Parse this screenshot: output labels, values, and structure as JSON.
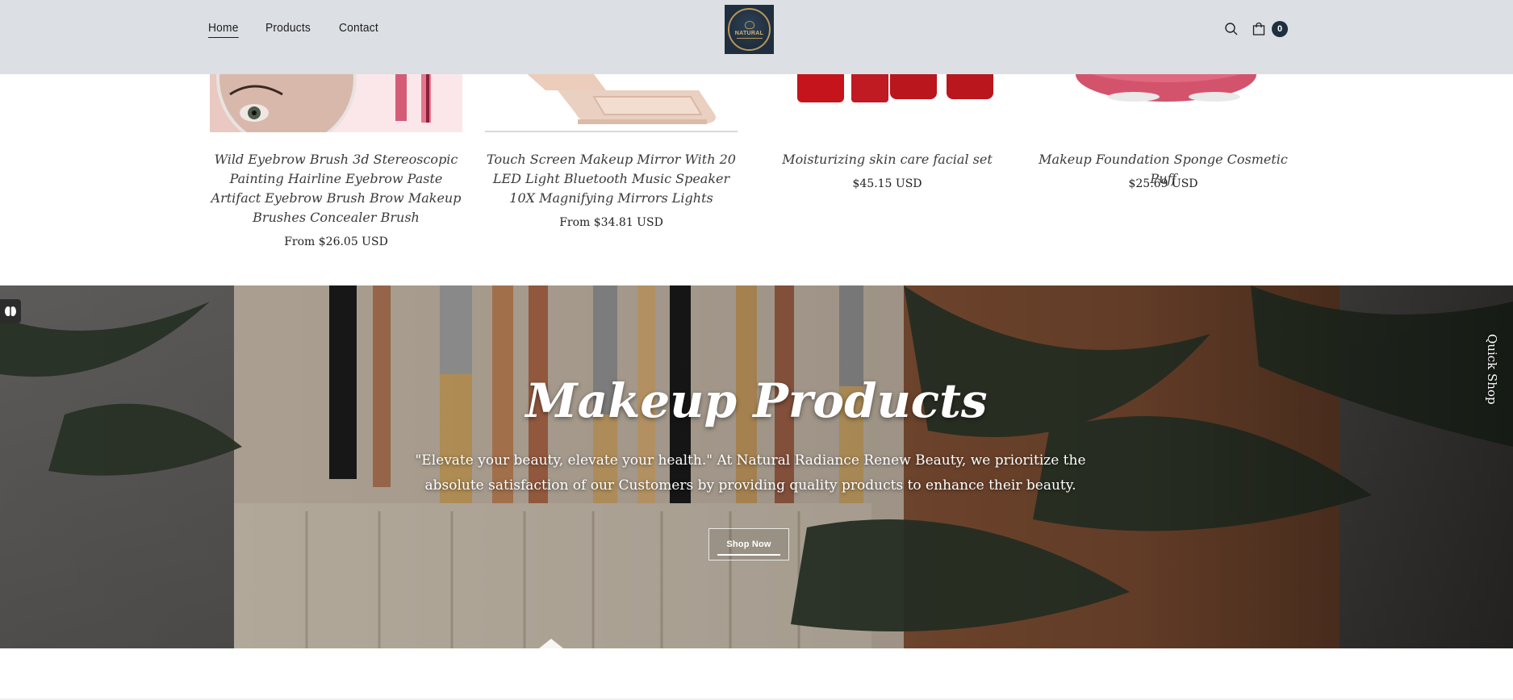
{
  "header": {
    "nav": [
      {
        "label": "Home",
        "active": true
      },
      {
        "label": "Products",
        "active": false
      },
      {
        "label": "Contact",
        "active": false
      }
    ],
    "logo_text": "NATURAL",
    "cart_count": "0",
    "icons": {
      "search": "search-icon",
      "cart": "cart-icon"
    }
  },
  "products": [
    {
      "title": "Wild Eyebrow Brush 3d Stereoscopic Painting Hairline Eyebrow Paste Artifact Eyebrow Brush Brow Makeup Brushes Concealer Brush",
      "price": "From $26.05 USD"
    },
    {
      "title": "Touch Screen Makeup Mirror With 20 LED Light Bluetooth Music Speaker 10X Magnifying Mirrors Lights",
      "price": "From $34.81 USD"
    },
    {
      "title": "Moisturizing skin care facial set",
      "price": "$45.15 USD"
    },
    {
      "title": "Makeup Foundation Sponge Cosmetic Puff",
      "price": "$25.69 USD"
    }
  ],
  "banner": {
    "title": "Makeup Products",
    "text": "\"Elevate your beauty, elevate your health.\" At Natural Radiance Renew Beauty, we prioritize the absolute satisfaction of our Customers by providing quality products to enhance their beauty.",
    "button_label": "Shop Now"
  },
  "quick_shop_label": "Quick Shop",
  "colors": {
    "header_bg": "#dcdfe3",
    "brand_dark": "#1f2f3f",
    "gold": "#b8975a"
  }
}
